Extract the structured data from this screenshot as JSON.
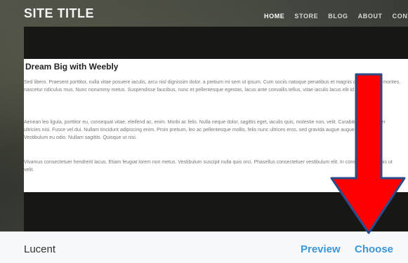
{
  "header": {
    "site_title": "SITE TITLE",
    "nav": [
      "HOME",
      "STORE",
      "BLOG",
      "ABOUT",
      "CONTAC"
    ]
  },
  "content": {
    "heading": "Dream Big with Weebly",
    "paragraphs": [
      "Sed libero. Praesent porttitor, nulla vitae posuere iaculis, arcu nisl dignissim dolor, a pretium mi sem ut ipsum. Cum sociis natoque penatibus et magnis dis parturient montes, nascetur ridiculus mus. Nunc nonummy metus. Suspendisse faucibus, nunc et pellentesque egestas, lacus ante convallis tellus, vitae iaculis lacus elit id tortor.",
      "Aenean leo ligula, porttitor eu, consequat vitae, eleifend ac, enim. Morbi ac felis. Nulla neque dolor, sagittis eget, iaculis quis, molestie non, velit. Curabitur ullamcorper ultricies nisi. Fusce vel dui. Nullam tincidunt adipiscing enim. Proin pretium, leo ac pellentesque mollis, felis nunc ultrices eros, sed gravida augue augue mollis justo. Vestibulum eu odio. Nullam sagittis. Quisque ut nisi.",
      "Vivamus consectetuer hendrerit lacus. Etiam feugiat lorem non metus. Vestibulum suscipit nulla quis orci. Phasellus consectetuer vestibulum elit. In consectetuer turpis ut velit."
    ]
  },
  "footer": {
    "theme_name": "Lucent",
    "preview_label": "Preview",
    "choose_label": "Choose"
  },
  "colors": {
    "link": "#3b96d6",
    "arrow": "#ff0000"
  },
  "icons": {
    "annotation": "down-arrow-icon"
  }
}
